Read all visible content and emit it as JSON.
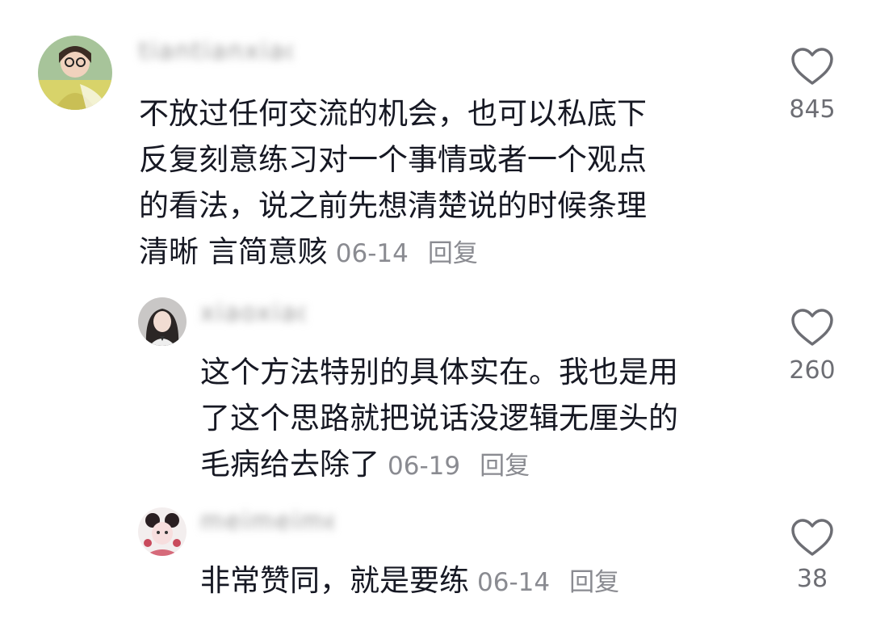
{
  "comments": [
    {
      "username": "tiantianxiao",
      "text": "不放过任何交流的机会，也可以私底下反复刻意练习对一个事情或者一个观点的看法，说之前先想清楚说的时候条理清晰 言简意赅",
      "lines": [
        "不放过任何交流的机会，也可以私底下",
        "反复刻意练习对一个事情或者一个观点",
        "的看法，说之前先想清楚说的时候条理",
        "清晰 言简意赅"
      ],
      "date": "06-14",
      "reply_label": "回复",
      "likes": "845"
    },
    {
      "username": "xiaoxiao",
      "lines": [
        "这个方法特别的具体实在。我也是用",
        "了这个思路就把说话没逻辑无厘头的",
        "毛病给去除了"
      ],
      "date": "06-19",
      "reply_label": "回复",
      "likes": "260"
    },
    {
      "username": "meimeimei",
      "lines": [
        "非常赞同，就是要练"
      ],
      "date": "06-14",
      "reply_label": "回复",
      "likes": "38"
    }
  ],
  "colors": {
    "text": "#161823",
    "meta": "#8a8b91",
    "heart": "#6d6e74"
  },
  "icons": {
    "like": "heart-outline-icon"
  }
}
